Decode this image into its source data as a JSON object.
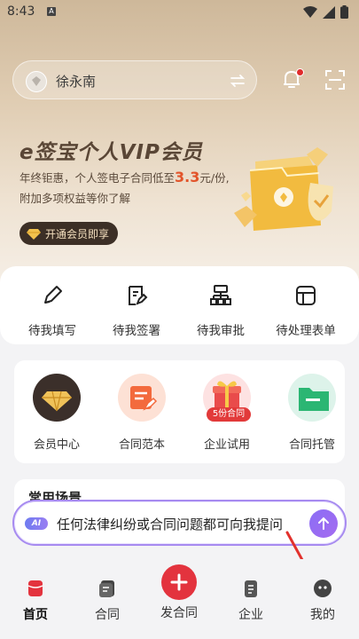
{
  "status_bar": {
    "time": "8:43",
    "notif_badge": "A"
  },
  "header": {
    "account_name": "徐永南"
  },
  "vip_banner": {
    "title": "e签宝个人VIP会员",
    "line1_prefix": "年终钜惠，个人签电子合同低至",
    "line1_price": "3.3",
    "line1_suffix": "元/份,",
    "line2": "附加多项权益等你了解",
    "button_label": "开通会员即享"
  },
  "quick_actions": [
    {
      "label": "待我填写",
      "icon": "pen-icon"
    },
    {
      "label": "待我签署",
      "icon": "sign-doc-icon"
    },
    {
      "label": "待我审批",
      "icon": "approval-tree-icon"
    },
    {
      "label": "待处理表单",
      "icon": "form-grid-icon"
    }
  ],
  "services": [
    {
      "label": "会员中心",
      "icon": "diamond-icon"
    },
    {
      "label": "合同范本",
      "icon": "template-doc-icon"
    },
    {
      "label": "企业试用",
      "icon": "gift-icon",
      "badge": "5份合同"
    },
    {
      "label": "合同托管",
      "icon": "folder-icon"
    }
  ],
  "scenes": {
    "title": "常用场景"
  },
  "ai_input": {
    "tag": "AI",
    "placeholder": "任何法律纠纷或合同问题都可向我提问"
  },
  "nav": {
    "items": [
      {
        "label": "首页",
        "icon": "home-icon",
        "active": true
      },
      {
        "label": "合同",
        "icon": "contract-stack-icon"
      },
      {
        "label": "发合同",
        "icon": "plus-icon"
      },
      {
        "label": "企业",
        "icon": "enterprise-icon"
      },
      {
        "label": "我的",
        "icon": "profile-face-icon"
      }
    ]
  },
  "colors": {
    "accent_red": "#e3333e",
    "ai_purple": "#8b6ef5",
    "vip_dark": "#3c2f26",
    "price_orange": "#e2542a"
  }
}
